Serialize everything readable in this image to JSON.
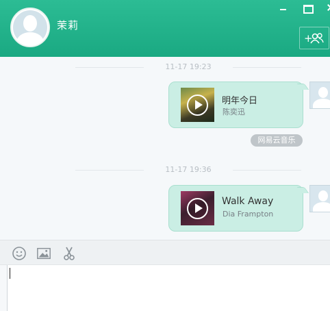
{
  "header": {
    "contact_name": "茉莉",
    "add_friend_label": "+"
  },
  "messages": [
    {
      "time": "11-17 19:23",
      "song_title": "明年今日",
      "artist": "陈奕迅",
      "source": "网易云音乐"
    },
    {
      "time": "11-17 19:36",
      "song_title": "Walk Away",
      "artist": "Dia Frampton"
    }
  ],
  "toolbar": {
    "tools": [
      "emoji-icon",
      "image-icon",
      "scissors-icon"
    ]
  },
  "input": {
    "value": ""
  },
  "colors": {
    "header": "#1fb088",
    "bubble": "#caeee4",
    "bubble_border": "#a9dfcf"
  }
}
